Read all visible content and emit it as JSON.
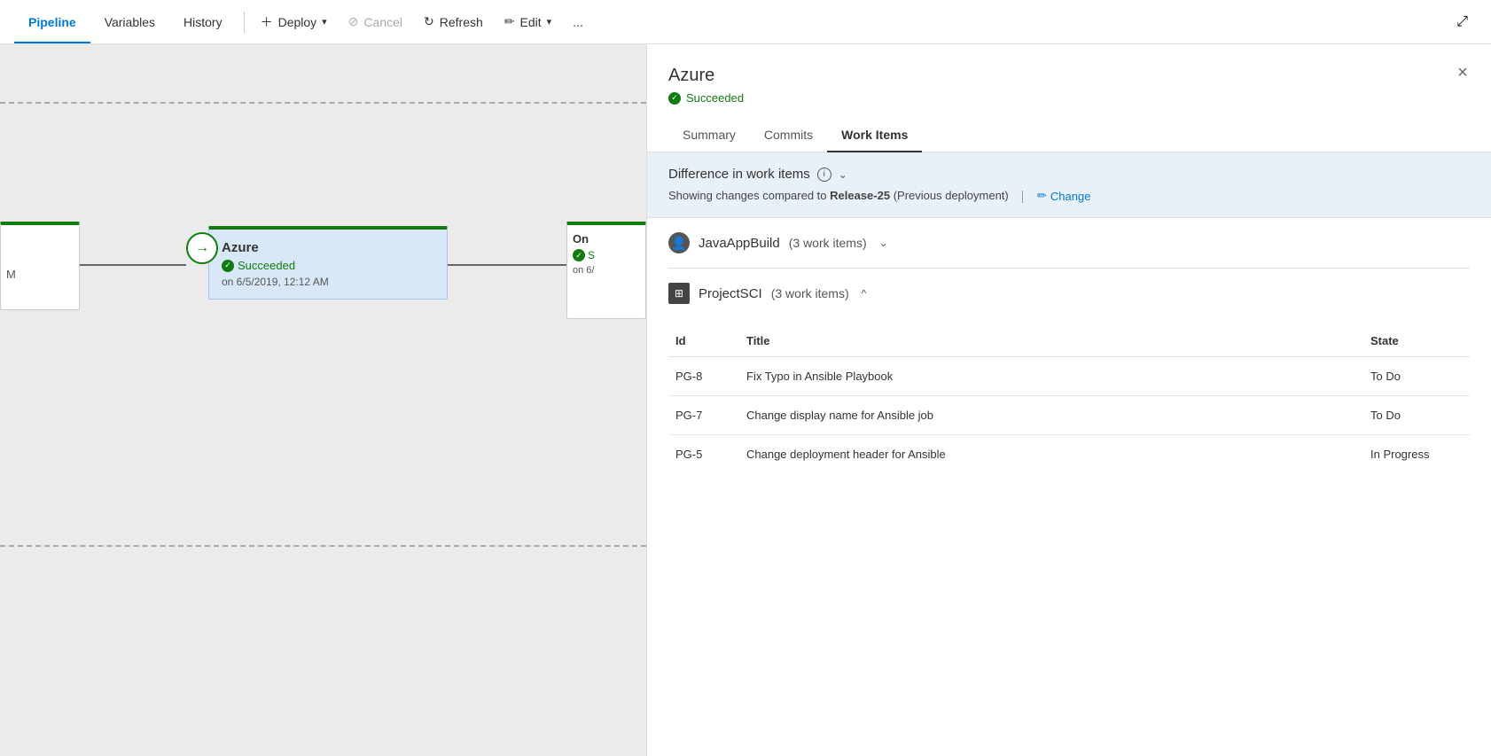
{
  "nav": {
    "tabs": [
      {
        "id": "pipeline",
        "label": "Pipeline",
        "active": true
      },
      {
        "id": "variables",
        "label": "Variables",
        "active": false
      },
      {
        "id": "history",
        "label": "History",
        "active": false
      }
    ],
    "actions": {
      "deploy": "Deploy",
      "cancel": "Cancel",
      "refresh": "Refresh",
      "edit": "Edit",
      "more": "..."
    }
  },
  "pipeline": {
    "stages": [
      {
        "id": "left-partial",
        "name": "M",
        "status": "",
        "date": ""
      },
      {
        "id": "azure",
        "name": "Azure",
        "status": "Succeeded",
        "date": "on 6/5/2019, 12:12 AM",
        "active": true
      },
      {
        "id": "right-partial",
        "name": "On",
        "status": "S",
        "date": "on 6/"
      }
    ]
  },
  "panel": {
    "title": "Azure",
    "status": "Succeeded",
    "close_label": "×",
    "tabs": [
      {
        "id": "summary",
        "label": "Summary",
        "active": false
      },
      {
        "id": "commits",
        "label": "Commits",
        "active": false
      },
      {
        "id": "workitems",
        "label": "Work Items",
        "active": true
      }
    ],
    "diff_section": {
      "header": "Difference in work items",
      "description_prefix": "Showing changes compared to ",
      "release_name": "Release-25",
      "description_suffix": " (Previous deployment)",
      "change_label": "Change",
      "info_icon": "i",
      "chevron": "⌄"
    },
    "groups": [
      {
        "id": "java-app-build",
        "icon_text": "👤",
        "name": "JavaAppBuild",
        "count_text": "(3 work items)",
        "expanded": false,
        "chevron": "⌄"
      },
      {
        "id": "project-sci",
        "icon_text": "🏢",
        "name": "ProjectSCI",
        "count_text": "(3 work items)",
        "expanded": true,
        "chevron": "^",
        "table": {
          "columns": [
            {
              "id": "id",
              "label": "Id"
            },
            {
              "id": "title",
              "label": "Title"
            },
            {
              "id": "state",
              "label": "State"
            }
          ],
          "rows": [
            {
              "id": "PG-8",
              "title": "Fix Typo in Ansible Playbook",
              "state": "To Do"
            },
            {
              "id": "PG-7",
              "title": "Change display name for Ansible job",
              "state": "To Do"
            },
            {
              "id": "PG-5",
              "title": "Change deployment header for Ansible",
              "state": "In Progress"
            }
          ]
        }
      }
    ]
  }
}
